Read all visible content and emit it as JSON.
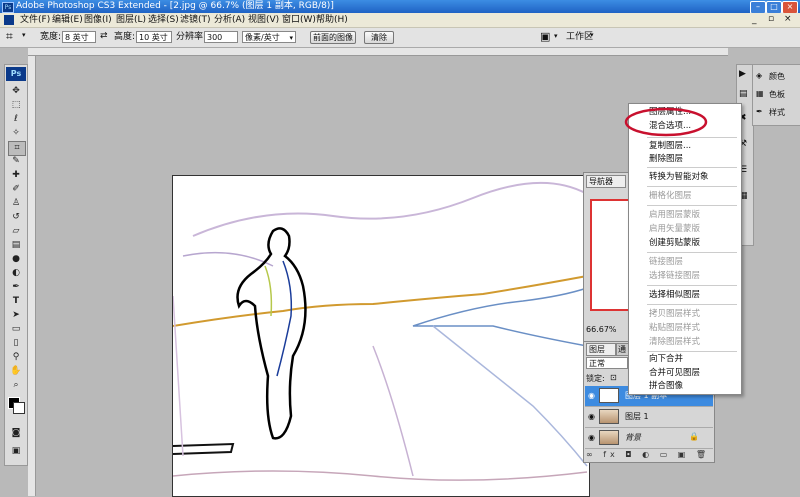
{
  "window": {
    "title": "Adobe Photoshop CS3 Extended - [2.jpg @ 66.7% (图层 1 副本, RGB/8)]",
    "ps_logo": "Ps"
  },
  "menu": {
    "items": [
      "文件(F)",
      "编辑(E)",
      "图像(I)",
      "图层(L)",
      "选择(S)",
      "滤镜(T)",
      "分析(A)",
      "视图(V)",
      "窗口(W)",
      "帮助(H)"
    ]
  },
  "options": {
    "width_label": "宽度:",
    "width_value": "8 英寸",
    "height_label": "高度:",
    "height_value": "10 英寸",
    "resolution_label": "分辨率:",
    "resolution_value": "300",
    "unit_value": "像素/英寸",
    "front_image_button": "前面的图像",
    "clear_button": "清除",
    "workspace_label": "工作区"
  },
  "panels": {
    "navigator_tab": "导航器",
    "zoom_value": "66.67%",
    "layers_tab": "图层",
    "channels_tab": "通",
    "blend_mode": "正常",
    "lock_label": "锁定:",
    "color_label": "颜色",
    "swatches_label": "色板",
    "styles_label": "样式"
  },
  "layers": [
    {
      "name": "图层 1 副本",
      "selected": true
    },
    {
      "name": "图层 1",
      "selected": false
    },
    {
      "name": "背景",
      "selected": false
    }
  ],
  "context_menu": {
    "items": [
      {
        "label": "图层属性...",
        "disabled": false
      },
      {
        "label": "混合选项...",
        "disabled": false,
        "highlighted": true
      },
      {
        "label": "复制图层...",
        "disabled": false
      },
      {
        "label": "删除图层",
        "disabled": false
      },
      {
        "label": "转换为智能对象",
        "disabled": false
      },
      {
        "label": "栅格化图层",
        "disabled": true
      },
      {
        "label": "启用图层蒙版",
        "disabled": true
      },
      {
        "label": "启用矢量蒙版",
        "disabled": true
      },
      {
        "label": "创建剪贴蒙版",
        "disabled": false
      },
      {
        "label": "链接图层",
        "disabled": true
      },
      {
        "label": "选择链接图层",
        "disabled": true
      },
      {
        "label": "选择相似图层",
        "disabled": false
      },
      {
        "label": "拷贝图层样式",
        "disabled": true
      },
      {
        "label": "粘贴图层样式",
        "disabled": true
      },
      {
        "label": "清除图层样式",
        "disabled": true
      },
      {
        "label": "向下合并",
        "disabled": false
      },
      {
        "label": "合并可见图层",
        "disabled": false
      },
      {
        "label": "拼合图像",
        "disabled": false
      }
    ]
  },
  "colors": {
    "titlebar": "#2a6fd0",
    "highlight_circle": "#c8102e",
    "selected_layer": "#3d8be0"
  }
}
